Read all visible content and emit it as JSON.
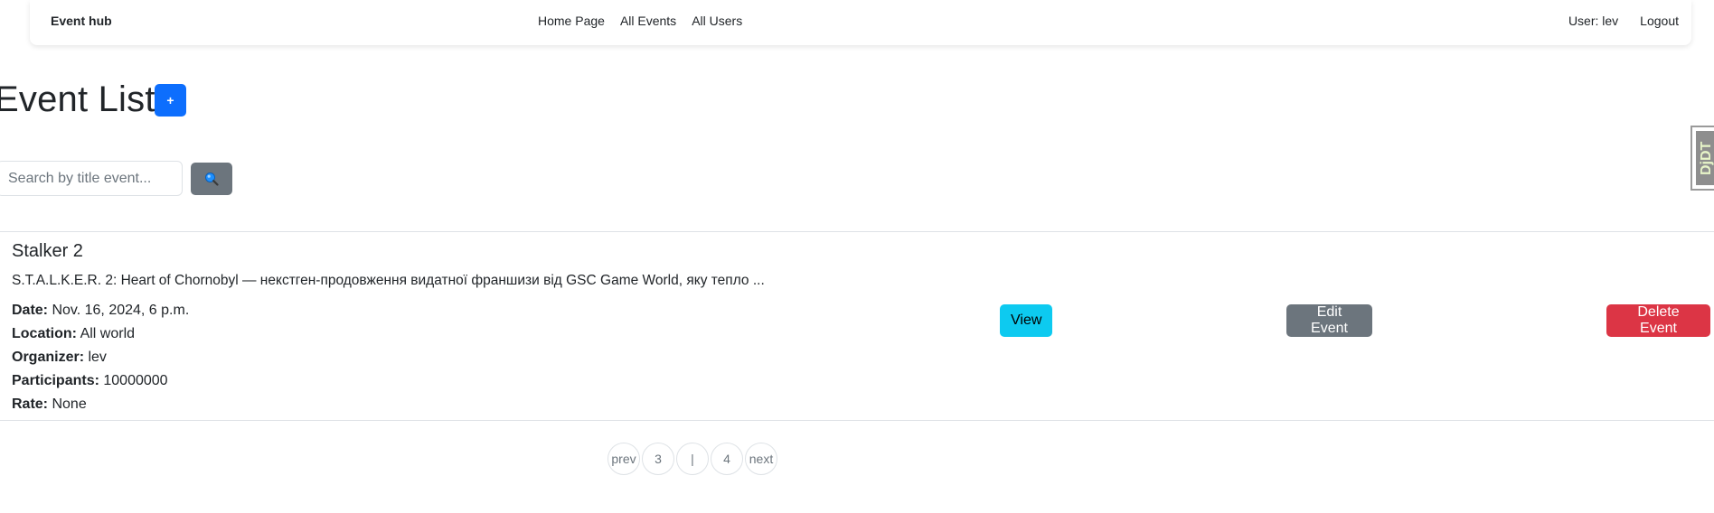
{
  "navbar": {
    "brand": "Event hub",
    "links": {
      "home": "Home Page",
      "events": "All Events",
      "users": "All Users"
    },
    "user": "User: lev",
    "logout": "Logout"
  },
  "page": {
    "title": "Event List",
    "add_label": "+"
  },
  "search": {
    "placeholder": "Search by title event...",
    "value": "",
    "button_icon": "magnifier-icon"
  },
  "edge_badge": {
    "text": "DjDT"
  },
  "events": [
    {
      "title": "Stalker 2",
      "description": "S.T.A.L.K.E.R. 2: Heart of Chornobyl — некстген-продовження видатної франшизи від GSC Game World, яку тепло ...",
      "fields": {
        "date_label": "Date:",
        "date": "Nov. 16, 2024, 6 p.m.",
        "location_label": "Location:",
        "location": "All world",
        "organizer_label": "Organizer:",
        "organizer": "lev",
        "participants_label": "Participants:",
        "participants": "10000000",
        "rate_label": "Rate:",
        "rate": "None"
      },
      "actions": {
        "view": "View",
        "edit": "Edit Event",
        "delete": "Delete Event"
      }
    }
  ],
  "pagination": {
    "prev": "prev",
    "page_a": "3",
    "separator": "|",
    "page_b": "4",
    "next": "next"
  },
  "colors": {
    "primary": "#0d6efd",
    "info": "#0dcaf0",
    "secondary": "#6c757d",
    "danger": "#dc3545"
  }
}
